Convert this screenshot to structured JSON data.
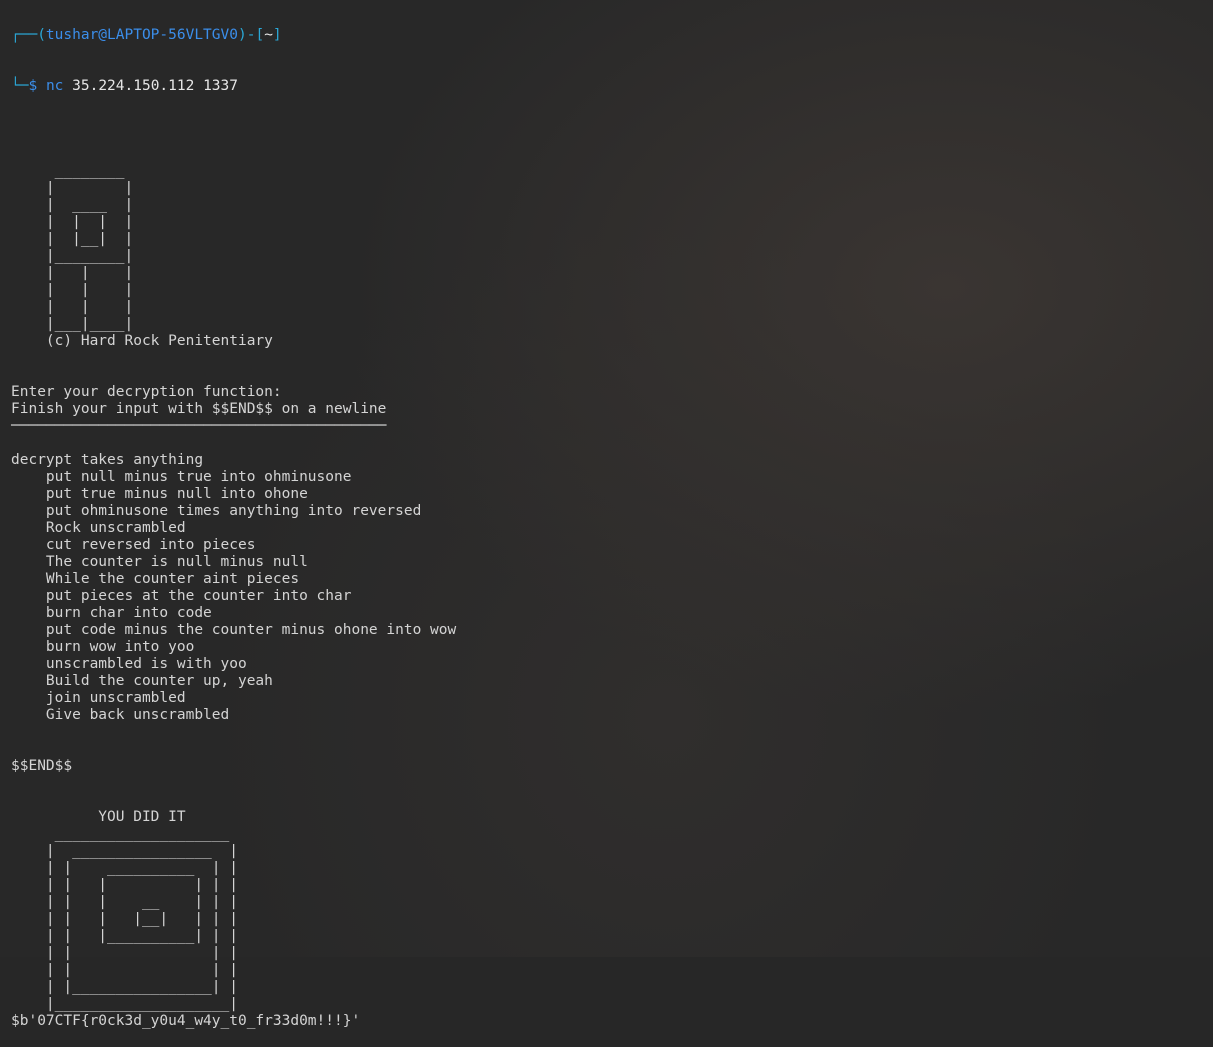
{
  "prompt": {
    "box_top": "┌──(",
    "user_host": "tushar@LAPTOP-56VLTGV0",
    "mid": ")-[",
    "dir": "~",
    "end": "]",
    "box_bottom": "└─",
    "dollar": "$ ",
    "command": "nc",
    "args": " 35.224.150.112 1337"
  },
  "output_lines": [
    "",
    "",
    "     ________",
    "    |        |",
    "    |  ____  |",
    "    |  |  |  |",
    "    |  |__|  |",
    "    |________|",
    "    |   |    |",
    "    |   |    |",
    "    |   |    |",
    "    |___|____|",
    "    (c) Hard Rock Penitentiary",
    "",
    "",
    "Enter your decryption function:",
    "Finish your input with $$END$$ on a newline",
    "───────────────────────────────────────────",
    "",
    "decrypt takes anything",
    "    put null minus true into ohminusone",
    "    put true minus null into ohone",
    "    put ohminusone times anything into reversed",
    "    Rock unscrambled",
    "    cut reversed into pieces",
    "    The counter is null minus null",
    "    While the counter aint pieces",
    "    put pieces at the counter into char",
    "    burn char into code",
    "    put code minus the counter minus ohone into wow",
    "    burn wow into yoo",
    "    unscrambled is with yoo",
    "    Build the counter up, yeah",
    "    join unscrambled",
    "    Give back unscrambled",
    "",
    "",
    "$$END$$",
    "",
    "",
    "          YOU DID IT",
    "     ____________________",
    "    |  ________________  |",
    "    | |    __________  | |",
    "    | |   |          | | |",
    "    | |   |    __    | | |",
    "    | |   |   |__|   | | |",
    "    | |   |__________| | |",
    "    | |                | |",
    "    | |                | |",
    "    | |________________| |",
    "    |____________________|",
    "$b'07CTF{r0ck3d_y0u4_w4y_t0_fr33d0m!!!}'"
  ],
  "colors": {
    "background": "#282828",
    "text": "#d4d4d4",
    "prompt_cyan": "#2aa7d6",
    "prompt_blue": "#3b8eea"
  }
}
